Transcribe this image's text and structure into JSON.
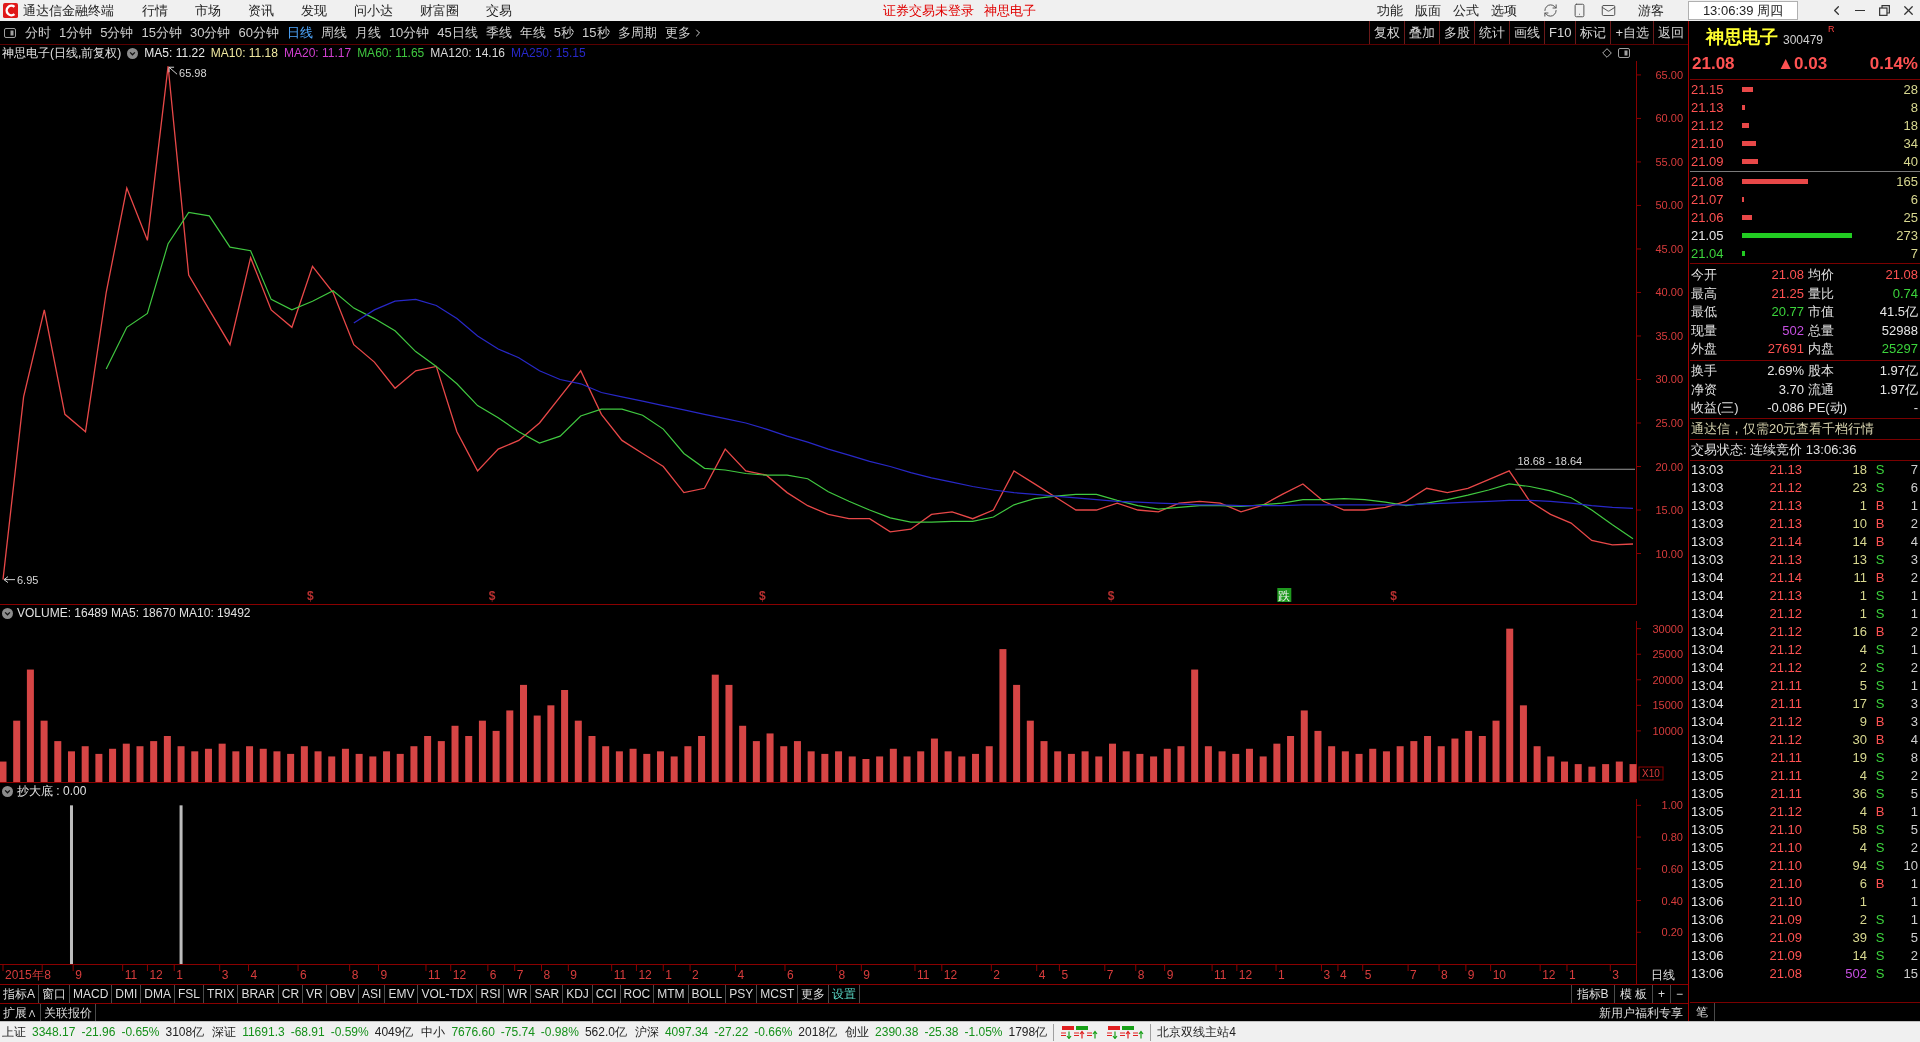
{
  "title_bar": {
    "app_name": "通达信金融终端",
    "menus": [
      "行情",
      "市场",
      "资讯",
      "发现",
      "问小达",
      "财富圈",
      "交易"
    ],
    "notice": "证券交易未登录",
    "notice_stock": "神思电子",
    "tools": [
      "功能",
      "版面",
      "公式",
      "选项"
    ],
    "user": "游客",
    "clock": "13:06:39 周四"
  },
  "period_bar": {
    "periods": [
      {
        "label": "分时",
        "selected": false
      },
      {
        "label": "1分钟",
        "selected": false
      },
      {
        "label": "5分钟",
        "selected": false
      },
      {
        "label": "15分钟",
        "selected": false
      },
      {
        "label": "30分钟",
        "selected": false
      },
      {
        "label": "60分钟",
        "selected": false
      },
      {
        "label": "日线",
        "selected": true
      },
      {
        "label": "周线",
        "selected": false
      },
      {
        "label": "月线",
        "selected": false
      },
      {
        "label": "10分钟",
        "selected": false
      },
      {
        "label": "45日线",
        "selected": false
      },
      {
        "label": "季线",
        "selected": false
      },
      {
        "label": "年线",
        "selected": false
      },
      {
        "label": "5秒",
        "selected": false
      },
      {
        "label": "15秒",
        "selected": false
      },
      {
        "label": "多周期",
        "selected": false
      }
    ],
    "more": "更多",
    "actions": [
      "复权",
      "叠加",
      "多股",
      "统计",
      "画线",
      "F10",
      "标记",
      "+自选",
      "返回"
    ]
  },
  "price_pane": {
    "title": "神思电子(日线,前复权)",
    "ma_labels": [
      {
        "text": "MA5: 11.22",
        "color": "#e8e8e8"
      },
      {
        "text": "MA10: 11.18",
        "color": "#f0e8a0"
      },
      {
        "text": "MA20: 11.17",
        "color": "#d040d0"
      },
      {
        "text": "MA60: 11.65",
        "color": "#40c840"
      },
      {
        "text": "MA120: 14.16",
        "color": "#d8d8d8"
      },
      {
        "text": "MA250: 15.15",
        "color": "#2828c8"
      }
    ],
    "chart_data": {
      "type": "line",
      "ylim": [
        4.2,
        66.6
      ],
      "categories": [
        null,
        null,
        null,
        null,
        null,
        null,
        null,
        null,
        null,
        null,
        null,
        null,
        null,
        null,
        null,
        null,
        null,
        null,
        null,
        null,
        null,
        null,
        null,
        null,
        null,
        null,
        null,
        null,
        null,
        null,
        null,
        null,
        null,
        null,
        null,
        null,
        null,
        null,
        null,
        null,
        null,
        null,
        null,
        null,
        null,
        null,
        null,
        null,
        null,
        null,
        null,
        null,
        null,
        null,
        null,
        null,
        null,
        null,
        null,
        null,
        null,
        null,
        null,
        null,
        null,
        null,
        null,
        null,
        null,
        null,
        null,
        null,
        null,
        null,
        null,
        null,
        null,
        null,
        null,
        null
      ],
      "yticks": [
        {
          "value": 10,
          "label": "10.00"
        },
        {
          "value": 15,
          "label": "15.00"
        },
        {
          "value": 20,
          "label": "20.00"
        },
        {
          "value": 25,
          "label": "25.00"
        },
        {
          "value": 30,
          "label": "30.00"
        },
        {
          "value": 35,
          "label": "35.00"
        },
        {
          "value": 40,
          "label": "40.00"
        },
        {
          "value": 45,
          "label": "45.00"
        },
        {
          "value": 50,
          "label": "50.00"
        },
        {
          "value": 55,
          "label": "55.00"
        },
        {
          "value": 60,
          "label": "60.00"
        },
        {
          "value": 65,
          "label": "65.00"
        }
      ],
      "series": [
        {
          "color": "#e84848",
          "values": [
            7,
            28,
            38,
            26,
            24,
            40,
            52,
            46,
            66,
            42,
            38,
            34,
            44,
            38,
            36,
            43,
            40,
            34,
            32,
            29,
            31,
            31.5,
            24,
            19.5,
            22,
            23,
            25,
            28,
            31,
            26,
            23,
            21.5,
            20,
            17,
            17.5,
            22,
            19.5,
            19,
            17,
            15.5,
            14.5,
            14,
            14,
            12.5,
            12.8,
            14.5,
            14.8,
            14,
            15,
            19.5,
            18,
            16.5,
            15,
            15,
            15.8,
            15,
            14.8,
            15.8,
            16,
            15.8,
            14.8,
            15.5,
            16.8,
            18,
            16,
            15,
            15,
            15.3,
            16,
            17.5,
            17,
            17.5,
            18.5,
            19.5,
            16,
            14.5,
            13.5,
            11.5,
            11,
            11.1
          ]
        },
        {
          "color": "#40c840",
          "values": [
            null,
            null,
            null,
            null,
            null,
            31.2,
            36,
            37.6,
            45.6,
            49.2,
            48.8,
            45.2,
            44.8,
            39.2,
            38,
            39,
            40.2,
            38.2,
            37,
            35.6,
            33.2,
            31.5,
            29.5,
            27,
            25.6,
            24,
            22.7,
            23.5,
            25.8,
            26.6,
            26.6,
            25.9,
            24.3,
            21.5,
            19.8,
            19.6,
            19.2,
            19,
            19,
            18.6,
            17.1,
            16,
            15,
            14.1,
            13.6,
            13.6,
            13.7,
            13.7,
            14.2,
            15.6,
            16.3,
            16.6,
            16.8,
            16.8,
            16.1,
            15.5,
            15.1,
            15.3,
            15.5,
            15.5,
            15.4,
            15.6,
            15.8,
            16.2,
            16.2,
            16.3,
            16.2,
            15.9,
            15.5,
            15.8,
            16.2,
            16.7,
            17.3,
            18,
            17.7,
            17.2,
            16.4,
            15,
            13.3,
            11.7
          ]
        },
        {
          "color": "#2828c8",
          "values": [
            null,
            null,
            null,
            null,
            null,
            null,
            null,
            null,
            null,
            null,
            null,
            null,
            null,
            null,
            null,
            null,
            null,
            36.5,
            38,
            39,
            39.2,
            38.5,
            37,
            35,
            33.5,
            32.5,
            31,
            30,
            29.5,
            28.5,
            28,
            27.5,
            27,
            26.5,
            26,
            25.5,
            25,
            24.3,
            23.5,
            22.8,
            22,
            21.3,
            20.6,
            20,
            19.3,
            18.7,
            18.2,
            17.7,
            17.3,
            17,
            16.8,
            16.6,
            16.4,
            16.2,
            16,
            15.9,
            15.8,
            15.7,
            15.6,
            15.6,
            15.5,
            15.5,
            15.5,
            15.6,
            15.6,
            15.6,
            15.6,
            15.6,
            15.6,
            15.7,
            15.8,
            15.9,
            16,
            16.1,
            16.1,
            16,
            15.8,
            15.5,
            15.3,
            15.2
          ]
        }
      ],
      "annotations": [
        "65.98",
        "6.95",
        "18.68 - 18.64"
      ]
    },
    "signals": [
      {
        "kind": "mark",
        "text": "$",
        "color": "#b83030"
      },
      {
        "kind": "mark",
        "text": "$",
        "color": "#b83030"
      },
      {
        "kind": "mark",
        "text": "$",
        "color": "#b83030"
      },
      {
        "kind": "mark",
        "text": "$",
        "color": "#b83030"
      },
      {
        "kind": "tag",
        "text": "跌",
        "color": "#1f9a1f"
      },
      {
        "kind": "mark",
        "text": "$",
        "color": "#b83030"
      }
    ]
  },
  "volume_pane": {
    "title": "VOLUME: 16489 MA5: 18670 MA10: 19492",
    "scale": "X10",
    "chart_data": {
      "type": "bar",
      "ylim": [
        0,
        31500
      ],
      "yticks": [
        {
          "value": 10000,
          "label": "10000"
        },
        {
          "value": 15000,
          "label": "15000"
        },
        {
          "value": 20000,
          "label": "20000"
        },
        {
          "value": 25000,
          "label": "25000"
        },
        {
          "value": 30000,
          "label": "30000"
        }
      ],
      "categories": [
        null,
        null,
        null,
        null,
        null,
        null,
        null,
        null,
        null,
        null,
        null,
        null,
        null,
        null,
        null,
        null,
        null,
        null,
        null,
        null,
        null,
        null,
        null,
        null,
        null,
        null,
        null,
        null,
        null,
        null,
        null,
        null,
        null,
        null,
        null,
        null,
        null,
        null,
        null,
        null,
        null,
        null,
        null,
        null,
        null,
        null,
        null,
        null,
        null,
        null,
        null,
        null,
        null,
        null,
        null,
        null,
        null,
        null,
        null,
        null,
        null,
        null,
        null,
        null,
        null,
        null,
        null,
        null,
        null,
        null,
        null,
        null,
        null,
        null,
        null,
        null,
        null,
        null,
        null,
        null,
        null,
        null,
        null,
        null,
        null,
        null,
        null,
        null,
        null,
        null,
        null,
        null,
        null,
        null,
        null,
        null,
        null,
        null,
        null,
        null,
        null,
        null,
        null,
        null,
        null,
        null,
        null,
        null,
        null,
        null,
        null,
        null,
        null,
        null,
        null,
        null,
        null,
        null,
        null,
        null
      ],
      "values": [
        4000,
        12000,
        22000,
        12000,
        8000,
        6000,
        7000,
        5500,
        6500,
        7500,
        7000,
        8000,
        9000,
        7000,
        6000,
        6500,
        7500,
        6000,
        7000,
        6500,
        6000,
        5500,
        7000,
        6000,
        5000,
        6500,
        5500,
        5000,
        6000,
        5500,
        7000,
        9000,
        8000,
        11000,
        9000,
        12000,
        10000,
        14000,
        19000,
        13000,
        15000,
        18000,
        12000,
        9000,
        7000,
        6000,
        6500,
        5500,
        6000,
        5000,
        7000,
        9000,
        21000,
        19000,
        11000,
        8000,
        9500,
        7000,
        8000,
        6000,
        5500,
        6000,
        5000,
        4500,
        5000,
        6500,
        5000,
        6000,
        8500,
        6000,
        5000,
        5500,
        7000,
        26000,
        19000,
        12000,
        8000,
        6000,
        5500,
        6000,
        5000,
        7500,
        6000,
        5500,
        5000,
        6500,
        7000,
        22000,
        7000,
        6000,
        5500,
        6500,
        5000,
        7500,
        9000,
        14000,
        10000,
        7000,
        6000,
        5500,
        6500,
        6000,
        7000,
        8000,
        9000,
        7000,
        8500,
        10000,
        9000,
        12000,
        30000,
        15000,
        7000,
        5000,
        4000,
        3500,
        3000,
        3500,
        4000,
        3500
      ]
    }
  },
  "indicator_pane": {
    "title": "抄大底 : 0.00",
    "chart_data": {
      "type": "bar",
      "ylim": [
        0,
        1.04
      ],
      "yticks": [
        {
          "value": 0.2,
          "label": "0.20"
        },
        {
          "value": 0.4,
          "label": "0.40"
        },
        {
          "value": 0.6,
          "label": "0.60"
        },
        {
          "value": 0.8,
          "label": "0.80"
        },
        {
          "value": 1,
          "label": "1.00"
        }
      ],
      "categories": [
        null,
        null,
        null,
        null,
        null,
        null,
        null,
        null,
        null,
        null,
        null,
        null,
        null,
        null,
        null,
        null,
        null,
        null,
        null,
        null,
        null,
        null,
        null,
        null,
        null,
        null,
        null,
        null,
        null,
        null,
        null,
        null,
        null,
        null,
        null,
        null,
        null,
        null,
        null,
        null,
        null,
        null,
        null,
        null,
        null,
        null,
        null,
        null,
        null,
        null,
        null,
        null,
        null,
        null,
        null,
        null,
        null,
        null,
        null,
        null,
        null,
        null,
        null,
        null,
        null,
        null,
        null,
        null,
        null,
        null,
        null,
        null,
        null,
        null,
        null,
        null,
        null,
        null,
        null,
        null,
        null,
        null,
        null,
        null,
        null,
        null,
        null,
        null,
        null,
        null,
        null,
        null,
        null,
        null,
        null,
        null,
        null,
        null,
        null,
        null,
        null,
        null,
        null,
        null,
        null,
        null,
        null,
        null,
        null,
        null,
        null,
        null,
        null,
        null,
        null,
        null,
        null,
        null,
        null,
        null
      ],
      "values": [
        0,
        0,
        0,
        0,
        0,
        1,
        0,
        0,
        0,
        0,
        0,
        0,
        0,
        1,
        0,
        0,
        0,
        0,
        0,
        0,
        0,
        0,
        0,
        0,
        0,
        0,
        0,
        0,
        0,
        0,
        0,
        0,
        0,
        0,
        0,
        0,
        0,
        0,
        0,
        0,
        0,
        0,
        0,
        0,
        0,
        0,
        0,
        0,
        0,
        0,
        0,
        0,
        0,
        0,
        0,
        0,
        0,
        0,
        0,
        0,
        0,
        0,
        0,
        0,
        0,
        0,
        0,
        0,
        0,
        0,
        0,
        0,
        0,
        0,
        0,
        0,
        0,
        0,
        0,
        0,
        0,
        0,
        0,
        0,
        0,
        0,
        0,
        0,
        0,
        0,
        0,
        0,
        0,
        0,
        0,
        0,
        0,
        0,
        0,
        0,
        0,
        0,
        0,
        0,
        0,
        0,
        0,
        0,
        0,
        0,
        0,
        0,
        0,
        0,
        0,
        0,
        0,
        0,
        0,
        0
      ]
    }
  },
  "time_axis": {
    "ticks": [
      "2015年",
      "8",
      "9",
      "11",
      "12",
      "1",
      "3",
      "4",
      "6",
      "8",
      "9",
      "11",
      "12",
      "6",
      "7",
      "8",
      "9",
      "11",
      "12",
      "1",
      "2",
      "4",
      "6",
      "8",
      "9",
      "11",
      "12",
      "2",
      "4",
      "5",
      "7",
      "8",
      "9",
      "11",
      "12",
      "1",
      "3",
      "4",
      "5",
      "7",
      "8",
      "9",
      "10",
      "12",
      "1",
      "3"
    ],
    "period": "日线"
  },
  "indicator_tabs": {
    "tabs": [
      {
        "label": "指标A",
        "accent": false
      },
      {
        "label": "窗口",
        "accent": false
      },
      {
        "label": "MACD",
        "accent": false
      },
      {
        "label": "DMI",
        "accent": false
      },
      {
        "label": "DMA",
        "accent": false
      },
      {
        "label": "FSL",
        "accent": false
      },
      {
        "label": "TRIX",
        "accent": false
      },
      {
        "label": "BRAR",
        "accent": false
      },
      {
        "label": "CR",
        "accent": false
      },
      {
        "label": "VR",
        "accent": false
      },
      {
        "label": "OBV",
        "accent": false
      },
      {
        "label": "ASI",
        "accent": false
      },
      {
        "label": "EMV",
        "accent": false
      },
      {
        "label": "VOL-TDX",
        "accent": false
      },
      {
        "label": "RSI",
        "accent": false
      },
      {
        "label": "WR",
        "accent": false
      },
      {
        "label": "SAR",
        "accent": false
      },
      {
        "label": "KDJ",
        "accent": false
      },
      {
        "label": "CCI",
        "accent": false
      },
      {
        "label": "ROC",
        "accent": false
      },
      {
        "label": "MTM",
        "accent": false
      },
      {
        "label": "BOLL",
        "accent": false
      },
      {
        "label": "PSY",
        "accent": false
      },
      {
        "label": "MCST",
        "accent": false
      },
      {
        "label": "更多",
        "accent": false
      },
      {
        "label": "设置",
        "accent": true
      }
    ],
    "right": [
      "指标B",
      "模 板",
      "+",
      "−"
    ]
  },
  "extension_bar": {
    "tabs": [
      "扩展∧",
      "关联报价"
    ],
    "promo": "新用户福利专享"
  },
  "quote_panel": {
    "name": "神思电子",
    "code": "300479",
    "flag": "R",
    "price": "21.08",
    "change": "▲0.03",
    "percent": "0.14%",
    "rising": true,
    "asks": [
      {
        "price": "21.15",
        "volume": "28",
        "kind": "up",
        "color": "#e84848"
      },
      {
        "price": "21.13",
        "volume": "8",
        "kind": "up",
        "color": "#e84848"
      },
      {
        "price": "21.12",
        "volume": "18",
        "kind": "up",
        "color": "#e84848"
      },
      {
        "price": "21.10",
        "volume": "34",
        "kind": "up",
        "color": "#e84848"
      },
      {
        "price": "21.09",
        "volume": "40",
        "kind": "up",
        "color": "#e84848"
      }
    ],
    "bids": [
      {
        "price": "21.08",
        "volume": "165",
        "kind": "up",
        "color": "#e84848"
      },
      {
        "price": "21.07",
        "volume": "6",
        "kind": "up",
        "color": "#e84848"
      },
      {
        "price": "21.06",
        "volume": "25",
        "kind": "up",
        "color": "#e84848"
      },
      {
        "price": "21.05",
        "volume": "273",
        "kind": "flat",
        "color": "#22cc22"
      },
      {
        "price": "21.04",
        "volume": "7",
        "kind": "down",
        "color": "#22cc22"
      }
    ],
    "stats": [
      {
        "label": "今开",
        "value": "21.08",
        "kind": "up"
      },
      {
        "label": "均价",
        "value": "21.08",
        "kind": "up"
      },
      {
        "label": "最高",
        "value": "21.25",
        "kind": "up"
      },
      {
        "label": "量比",
        "value": "0.74",
        "kind": "down"
      },
      {
        "label": "最低",
        "value": "20.77",
        "kind": "down"
      },
      {
        "label": "市值",
        "value": "41.5亿",
        "kind": "flat"
      },
      {
        "label": "现量",
        "value": "502",
        "kind": "volume"
      },
      {
        "label": "总量",
        "value": "52988",
        "kind": "flat"
      },
      {
        "label": "外盘",
        "value": "27691",
        "kind": "up"
      },
      {
        "label": "内盘",
        "value": "25297",
        "kind": "down"
      }
    ],
    "fundamentals": [
      {
        "label": "换手",
        "value": "2.69%",
        "kind": "flat"
      },
      {
        "label": "股本",
        "value": "1.97亿",
        "kind": "flat"
      },
      {
        "label": "净资",
        "value": "3.70",
        "kind": "flat"
      },
      {
        "label": "流通",
        "value": "1.97亿",
        "kind": "flat"
      },
      {
        "label": "收益(三)",
        "value": "-0.086",
        "kind": "flat"
      },
      {
        "label": "PE(动)",
        "value": "-",
        "kind": "flat"
      }
    ],
    "promo": "通达信，仅需20元查看千档行情",
    "status": "交易状态: 连续竞价 13:06:36",
    "trades": [
      {
        "time": "13:03",
        "price": "21.13",
        "rising": true,
        "volume": "18",
        "large": false,
        "side": "S",
        "kind": "sell",
        "count": "7"
      },
      {
        "time": "13:03",
        "price": "21.12",
        "rising": true,
        "volume": "23",
        "large": false,
        "side": "S",
        "kind": "sell",
        "count": "6"
      },
      {
        "time": "13:03",
        "price": "21.13",
        "rising": true,
        "volume": "1",
        "large": false,
        "side": "B",
        "kind": "buy",
        "count": "1"
      },
      {
        "time": "13:03",
        "price": "21.13",
        "rising": true,
        "volume": "10",
        "large": false,
        "side": "B",
        "kind": "buy",
        "count": "2"
      },
      {
        "time": "13:03",
        "price": "21.14",
        "rising": true,
        "volume": "14",
        "large": false,
        "side": "B",
        "kind": "buy",
        "count": "4"
      },
      {
        "time": "13:03",
        "price": "21.13",
        "rising": true,
        "volume": "13",
        "large": false,
        "side": "S",
        "kind": "sell",
        "count": "3"
      },
      {
        "time": "13:04",
        "price": "21.14",
        "rising": true,
        "volume": "11",
        "large": false,
        "side": "B",
        "kind": "buy",
        "count": "2"
      },
      {
        "time": "13:04",
        "price": "21.13",
        "rising": true,
        "volume": "1",
        "large": false,
        "side": "S",
        "kind": "sell",
        "count": "1"
      },
      {
        "time": "13:04",
        "price": "21.12",
        "rising": true,
        "volume": "1",
        "large": false,
        "side": "S",
        "kind": "sell",
        "count": "1"
      },
      {
        "time": "13:04",
        "price": "21.12",
        "rising": true,
        "volume": "16",
        "large": false,
        "side": "B",
        "kind": "buy",
        "count": "2"
      },
      {
        "time": "13:04",
        "price": "21.12",
        "rising": true,
        "volume": "4",
        "large": false,
        "side": "S",
        "kind": "sell",
        "count": "1"
      },
      {
        "time": "13:04",
        "price": "21.12",
        "rising": true,
        "volume": "2",
        "large": false,
        "side": "S",
        "kind": "sell",
        "count": "2"
      },
      {
        "time": "13:04",
        "price": "21.11",
        "rising": true,
        "volume": "5",
        "large": false,
        "side": "S",
        "kind": "sell",
        "count": "1"
      },
      {
        "time": "13:04",
        "price": "21.11",
        "rising": true,
        "volume": "17",
        "large": false,
        "side": "S",
        "kind": "sell",
        "count": "3"
      },
      {
        "time": "13:04",
        "price": "21.12",
        "rising": true,
        "volume": "9",
        "large": false,
        "side": "B",
        "kind": "buy",
        "count": "3"
      },
      {
        "time": "13:04",
        "price": "21.12",
        "rising": true,
        "volume": "30",
        "large": false,
        "side": "B",
        "kind": "buy",
        "count": "4"
      },
      {
        "time": "13:05",
        "price": "21.11",
        "rising": true,
        "volume": "19",
        "large": false,
        "side": "S",
        "kind": "sell",
        "count": "8"
      },
      {
        "time": "13:05",
        "price": "21.11",
        "rising": true,
        "volume": "4",
        "large": false,
        "side": "S",
        "kind": "sell",
        "count": "2"
      },
      {
        "time": "13:05",
        "price": "21.11",
        "rising": true,
        "volume": "36",
        "large": false,
        "side": "S",
        "kind": "sell",
        "count": "5"
      },
      {
        "time": "13:05",
        "price": "21.12",
        "rising": true,
        "volume": "4",
        "large": false,
        "side": "B",
        "kind": "buy",
        "count": "1"
      },
      {
        "time": "13:05",
        "price": "21.10",
        "rising": true,
        "volume": "58",
        "large": false,
        "side": "S",
        "kind": "sell",
        "count": "5"
      },
      {
        "time": "13:05",
        "price": "21.10",
        "rising": true,
        "volume": "4",
        "large": false,
        "side": "S",
        "kind": "sell",
        "count": "2"
      },
      {
        "time": "13:05",
        "price": "21.10",
        "rising": true,
        "volume": "94",
        "large": false,
        "side": "S",
        "kind": "sell",
        "count": "10"
      },
      {
        "time": "13:05",
        "price": "21.10",
        "rising": true,
        "volume": "6",
        "large": false,
        "side": "B",
        "kind": "buy",
        "count": "1"
      },
      {
        "time": "13:06",
        "price": "21.10",
        "rising": true,
        "volume": "1",
        "large": false,
        "count": "1"
      },
      {
        "time": "13:06",
        "price": "21.09",
        "rising": true,
        "volume": "2",
        "large": false,
        "side": "S",
        "kind": "sell",
        "count": "1"
      },
      {
        "time": "13:06",
        "price": "21.09",
        "rising": true,
        "volume": "39",
        "large": false,
        "side": "S",
        "kind": "sell",
        "count": "5"
      },
      {
        "time": "13:06",
        "price": "21.09",
        "rising": true,
        "volume": "14",
        "large": false,
        "side": "S",
        "kind": "sell",
        "count": "2"
      },
      {
        "time": "13:06",
        "price": "21.08",
        "rising": true,
        "volume": "502",
        "large": true,
        "side": "S",
        "kind": "sell",
        "count": "15"
      }
    ],
    "tab": "笔"
  },
  "status_bar": {
    "indices": [
      {
        "name": "上证",
        "value": "3348.17",
        "change": "-21.96",
        "percent": "-0.65%",
        "amount": "3108亿",
        "kind": "down"
      },
      {
        "name": "深证",
        "value": "11691.3",
        "change": "-68.91",
        "percent": "-0.59%",
        "amount": "4049亿",
        "kind": "down"
      },
      {
        "name": "中小",
        "value": "7676.60",
        "change": "-75.74",
        "percent": "-0.98%",
        "amount": "562.0亿",
        "kind": "down"
      },
      {
        "name": "沪深",
        "value": "4097.34",
        "change": "-27.22",
        "percent": "-0.66%",
        "amount": "2018亿",
        "kind": "down"
      },
      {
        "name": "创业",
        "value": "2390.38",
        "change": "-25.38",
        "percent": "-1.05%",
        "amount": "1798亿",
        "kind": "down"
      }
    ],
    "server": "北京双线主站4"
  }
}
